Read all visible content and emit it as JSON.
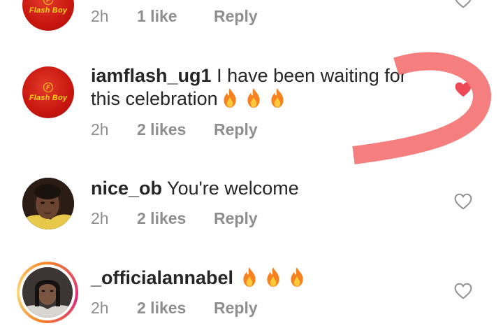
{
  "comments": [
    {
      "username": "",
      "text": "",
      "time": "2h",
      "likes": "1 like",
      "reply": "Reply",
      "avatar_logo_text": "Flash Boy",
      "avatar_logo_mark": "F",
      "liked": false
    },
    {
      "username": "iamflash_ug1",
      "text": "I have been waiting for this celebration",
      "emoji_icons": [
        "fire-icon",
        "fire-icon",
        "fire-icon"
      ],
      "time": "2h",
      "likes": "2 likes",
      "reply": "Reply",
      "avatar_logo_text": "Flash Boy",
      "avatar_logo_mark": "F",
      "liked": true
    },
    {
      "username": "nice_ob",
      "text": "You're welcome",
      "time": "2h",
      "likes": "2 likes",
      "reply": "Reply",
      "liked": false
    },
    {
      "username": "_officialannabel",
      "text": "",
      "emoji_icons": [
        "fire-icon",
        "fire-icon",
        "fire-icon"
      ],
      "time": "2h",
      "likes": "2 likes",
      "reply": "Reply",
      "has_story_ring": true,
      "liked": false
    }
  ],
  "colors": {
    "liked_heart": "#ed4956",
    "meta_text": "#8e8e8e",
    "annotation_stroke": "#f47777"
  }
}
